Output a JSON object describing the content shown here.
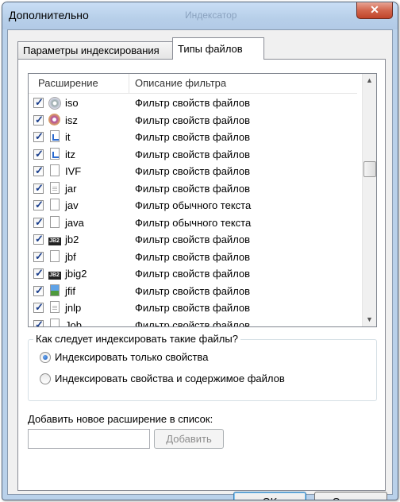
{
  "window": {
    "title": "Дополнительно",
    "ghost_title": "Индексатор",
    "close_symbol": "✕"
  },
  "tabs": [
    {
      "label": "Параметры индексирования",
      "active": false
    },
    {
      "label": "Типы файлов",
      "active": true
    }
  ],
  "list": {
    "columns": [
      "Расширение",
      "Описание фильтра"
    ],
    "rows": [
      {
        "checked": true,
        "icon": "cd-icon",
        "ext": "iso",
        "desc": "Фильтр свойств файлов"
      },
      {
        "checked": true,
        "icon": "disc-image-icon",
        "ext": "isz",
        "desc": "Фильтр свойств файлов"
      },
      {
        "checked": true,
        "icon": "media-file-icon",
        "ext": "it",
        "desc": "Фильтр свойств файлов"
      },
      {
        "checked": true,
        "icon": "media-file-icon",
        "ext": "itz",
        "desc": "Фильтр свойств файлов"
      },
      {
        "checked": true,
        "icon": "blank-file-icon",
        "ext": "IVF",
        "desc": "Фильтр свойств файлов"
      },
      {
        "checked": true,
        "icon": "archive-file-icon",
        "ext": "jar",
        "desc": "Фильтр свойств файлов"
      },
      {
        "checked": true,
        "icon": "blank-file-icon",
        "ext": "jav",
        "desc": "Фильтр обычного текста"
      },
      {
        "checked": true,
        "icon": "blank-file-icon",
        "ext": "java",
        "desc": "Фильтр обычного текста"
      },
      {
        "checked": true,
        "icon": "jbig-file-icon",
        "ext": "jb2",
        "desc": "Фильтр свойств файлов"
      },
      {
        "checked": true,
        "icon": "blank-file-icon",
        "ext": "jbf",
        "desc": "Фильтр свойств файлов"
      },
      {
        "checked": true,
        "icon": "jbig-file-icon",
        "ext": "jbig2",
        "desc": "Фильтр свойств файлов"
      },
      {
        "checked": true,
        "icon": "image-file-icon",
        "ext": "jfif",
        "desc": "Фильтр свойств файлов"
      },
      {
        "checked": true,
        "icon": "archive-file-icon",
        "ext": "jnlp",
        "desc": "Фильтр свойств файлов"
      },
      {
        "checked": true,
        "icon": "blank-file-icon",
        "ext": "Job",
        "desc": "Фильтр свойств файлов"
      }
    ]
  },
  "index_group": {
    "legend": "Как следует индексировать такие файлы?",
    "options": [
      {
        "label": "Индексировать только свойства",
        "selected": true
      },
      {
        "label": "Индексировать свойства и содержимое файлов",
        "selected": false
      }
    ]
  },
  "add_extension": {
    "label": "Добавить новое расширение в список:",
    "value": "",
    "button": "Добавить"
  },
  "buttons": {
    "ok": "OK",
    "cancel": "Отмена"
  },
  "colors": {
    "frame": "#b9d1ea",
    "close": "#c0442a",
    "accent": "#3c7fb1"
  }
}
